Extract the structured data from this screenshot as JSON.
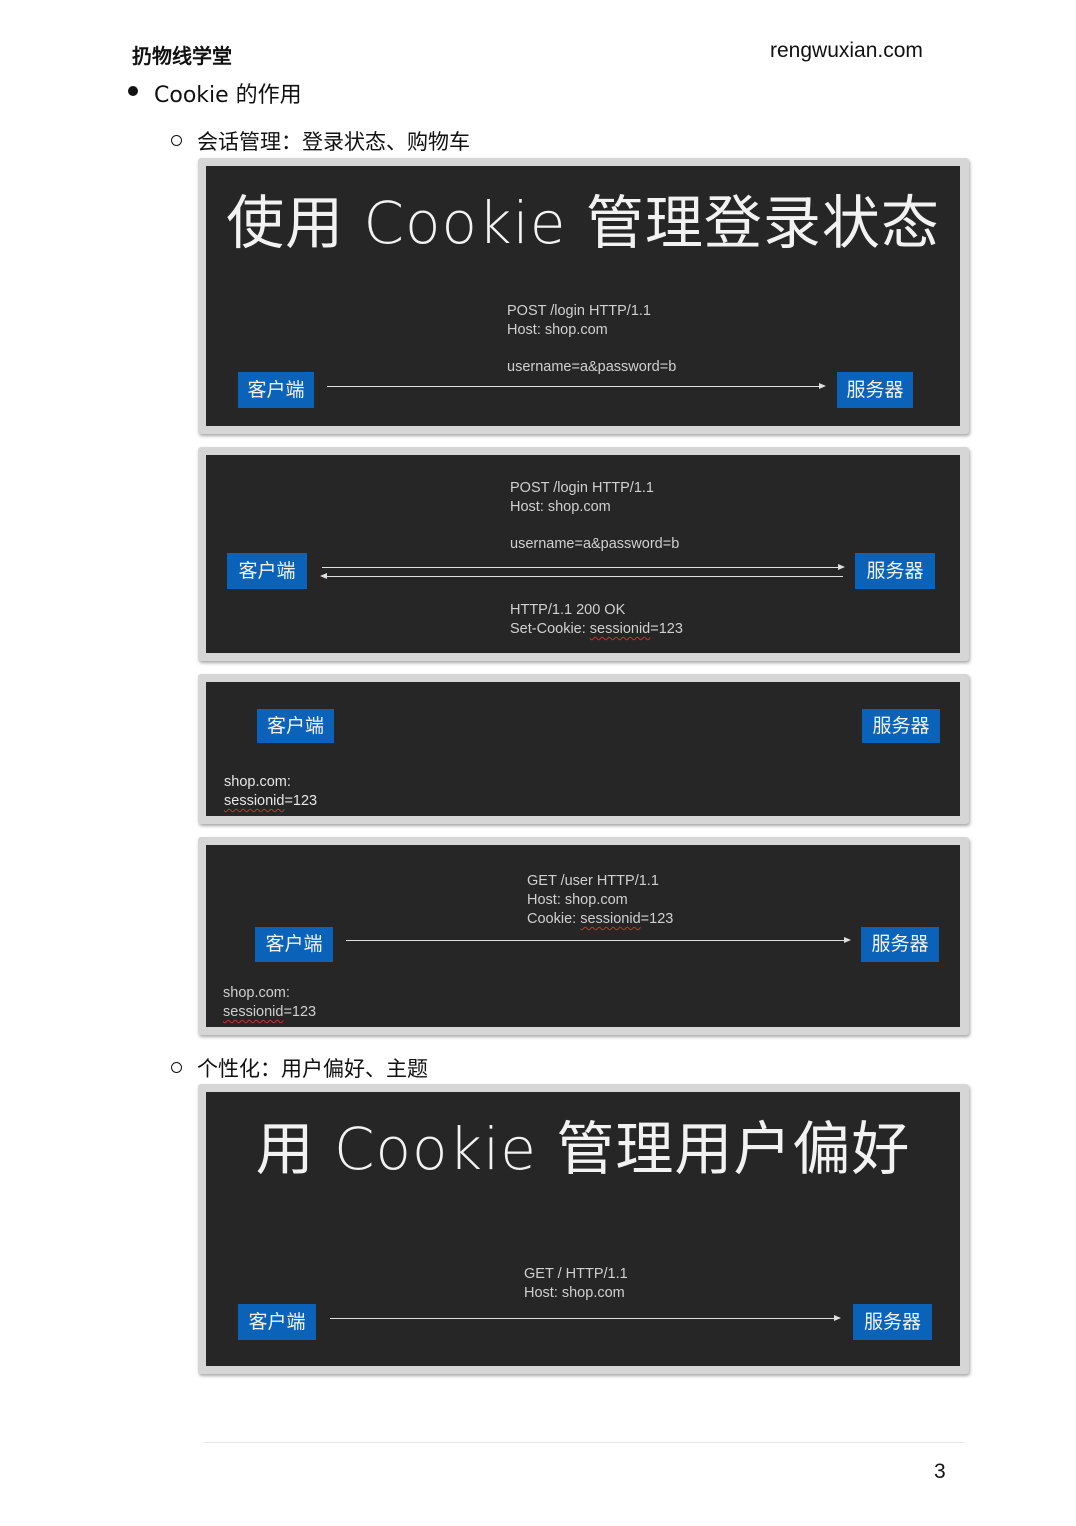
{
  "header": {
    "left": "扔物线学堂",
    "right": "rengwuxian.com"
  },
  "bullet": {
    "label": "Cookie 的作用"
  },
  "subsections": [
    {
      "label": "会话管理：登录状态、购物车"
    },
    {
      "label": "个性化：用户偏好、主题"
    }
  ],
  "slides": {
    "s1": {
      "title": "使用 Cookie 管理登录状态",
      "client": "客户端",
      "server": "服务器",
      "request": [
        "POST /login HTTP/1.1",
        "Host: shop.com",
        "username=a&password=b"
      ]
    },
    "s2": {
      "client": "客户端",
      "server": "服务器",
      "request": [
        "POST /login HTTP/1.1",
        "Host: shop.com",
        "username=a&password=b"
      ],
      "response": [
        "HTTP/1.1 200 OK",
        "Set-Cookie: ",
        "sessionid",
        "=123"
      ]
    },
    "s3": {
      "client": "客户端",
      "server": "服务器",
      "store": [
        "shop.com:",
        "sessionid",
        "=123"
      ]
    },
    "s4": {
      "client": "客户端",
      "server": "服务器",
      "request": [
        "GET /user HTTP/1.1",
        "Host: shop.com",
        "Cookie: ",
        "sessionid",
        "=123"
      ],
      "store": [
        "shop.com:",
        "sessionid",
        "=123"
      ]
    },
    "s5": {
      "title": "用 Cookie 管理用户偏好",
      "client": "客户端",
      "server": "服务器",
      "request": [
        "GET / HTTP/1.1",
        "Host: shop.com"
      ]
    }
  },
  "footer": {
    "page": "3"
  }
}
